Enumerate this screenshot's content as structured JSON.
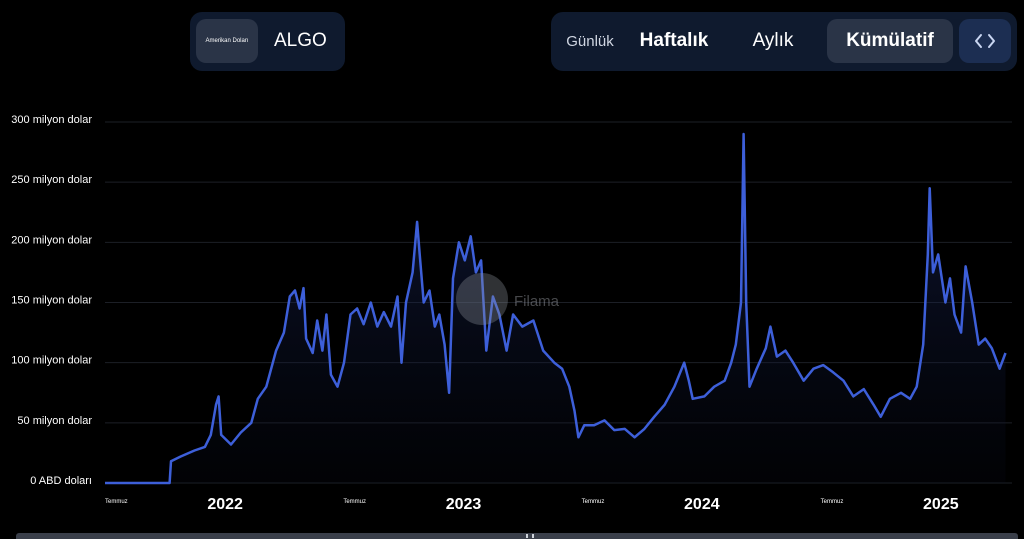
{
  "currency": {
    "label": "Amerikan Doları",
    "asset": "ALGO"
  },
  "range_tabs": [
    {
      "label": "Günlük",
      "active": false
    },
    {
      "label": "Haftalık",
      "active": false
    },
    {
      "label": "Aylık",
      "active": false
    },
    {
      "label": "Kümülatif",
      "active": true
    }
  ],
  "embed": {
    "icon": "code-brackets-icon"
  },
  "watermark": {
    "text": "Filama"
  },
  "colors": {
    "line": "#3d5fd9",
    "background": "#000000",
    "panel": "#0f1a2e",
    "active_tab": "#2a3447",
    "gridline": "#1c1f26",
    "axis_text": "#ffffff"
  },
  "chart_data": {
    "type": "area",
    "title": "",
    "xlabel": "",
    "ylabel": "",
    "grid": true,
    "ylim": [
      0,
      300
    ],
    "y_ticks": [
      {
        "value": 0,
        "label": "0 ABD doları"
      },
      {
        "value": 50,
        "label": "50 milyon dolar"
      },
      {
        "value": 100,
        "label": "100 milyon dolar"
      },
      {
        "value": 150,
        "label": "150 milyon dolar"
      },
      {
        "value": 200,
        "label": "200 milyon dolar"
      },
      {
        "value": 250,
        "label": "250 milyon dolar"
      },
      {
        "value": 300,
        "label": "300 milyon dolar"
      }
    ],
    "x_ticks": [
      {
        "date": "2021-07-01",
        "label": "Temmuz",
        "major": false
      },
      {
        "date": "2022-01-01",
        "label": "2022",
        "major": true
      },
      {
        "date": "2022-07-01",
        "label": "Temmuz",
        "major": false
      },
      {
        "date": "2023-01-01",
        "label": "2023",
        "major": true
      },
      {
        "date": "2023-07-01",
        "label": "Temmuz",
        "major": false
      },
      {
        "date": "2024-01-01",
        "label": "2024",
        "major": true
      },
      {
        "date": "2024-07-01",
        "label": "Temmuz",
        "major": false
      },
      {
        "date": "2025-01-01",
        "label": "2025",
        "major": true
      }
    ],
    "xlim": [
      "2021-07-01",
      "2025-04-20"
    ],
    "series": [
      {
        "unit": "milyon dolar",
        "points": [
          [
            "2021-07-01",
            0
          ],
          [
            "2021-09-15",
            0
          ],
          [
            "2021-10-08",
            0
          ],
          [
            "2021-10-10",
            18
          ],
          [
            "2021-10-25",
            22
          ],
          [
            "2021-11-15",
            27
          ],
          [
            "2021-12-01",
            30
          ],
          [
            "2021-12-10",
            40
          ],
          [
            "2021-12-18",
            65
          ],
          [
            "2021-12-22",
            72
          ],
          [
            "2021-12-26",
            40
          ],
          [
            "2022-01-10",
            32
          ],
          [
            "2022-01-25",
            42
          ],
          [
            "2022-02-10",
            50
          ],
          [
            "2022-02-20",
            70
          ],
          [
            "2022-03-05",
            80
          ],
          [
            "2022-03-20",
            110
          ],
          [
            "2022-04-01",
            125
          ],
          [
            "2022-04-10",
            155
          ],
          [
            "2022-04-18",
            160
          ],
          [
            "2022-04-25",
            145
          ],
          [
            "2022-05-01",
            162
          ],
          [
            "2022-05-05",
            120
          ],
          [
            "2022-05-15",
            108
          ],
          [
            "2022-05-22",
            135
          ],
          [
            "2022-05-30",
            110
          ],
          [
            "2022-06-05",
            140
          ],
          [
            "2022-06-12",
            90
          ],
          [
            "2022-06-22",
            80
          ],
          [
            "2022-07-02",
            100
          ],
          [
            "2022-07-12",
            140
          ],
          [
            "2022-07-22",
            145
          ],
          [
            "2022-08-01",
            132
          ],
          [
            "2022-08-12",
            150
          ],
          [
            "2022-08-22",
            130
          ],
          [
            "2022-09-01",
            142
          ],
          [
            "2022-09-12",
            130
          ],
          [
            "2022-09-22",
            155
          ],
          [
            "2022-09-28",
            100
          ],
          [
            "2022-10-05",
            150
          ],
          [
            "2022-10-15",
            175
          ],
          [
            "2022-10-22",
            217
          ],
          [
            "2022-10-26",
            190
          ],
          [
            "2022-11-01",
            150
          ],
          [
            "2022-11-10",
            160
          ],
          [
            "2022-11-18",
            130
          ],
          [
            "2022-11-25",
            140
          ],
          [
            "2022-12-03",
            115
          ],
          [
            "2022-12-10",
            75
          ],
          [
            "2022-12-16",
            170
          ],
          [
            "2022-12-25",
            200
          ],
          [
            "2023-01-03",
            185
          ],
          [
            "2023-01-12",
            205
          ],
          [
            "2023-01-20",
            175
          ],
          [
            "2023-01-28",
            185
          ],
          [
            "2023-02-05",
            110
          ],
          [
            "2023-02-15",
            155
          ],
          [
            "2023-02-25",
            140
          ],
          [
            "2023-03-08",
            110
          ],
          [
            "2023-03-18",
            140
          ],
          [
            "2023-04-01",
            130
          ],
          [
            "2023-04-18",
            135
          ],
          [
            "2023-05-03",
            110
          ],
          [
            "2023-05-20",
            100
          ],
          [
            "2023-06-01",
            95
          ],
          [
            "2023-06-12",
            80
          ],
          [
            "2023-06-20",
            60
          ],
          [
            "2023-06-26",
            38
          ],
          [
            "2023-07-05",
            48
          ],
          [
            "2023-07-20",
            48
          ],
          [
            "2023-08-05",
            52
          ],
          [
            "2023-08-20",
            44
          ],
          [
            "2023-09-05",
            45
          ],
          [
            "2023-09-20",
            38
          ],
          [
            "2023-10-05",
            45
          ],
          [
            "2023-10-20",
            55
          ],
          [
            "2023-11-05",
            65
          ],
          [
            "2023-11-20",
            80
          ],
          [
            "2023-12-05",
            100
          ],
          [
            "2023-12-12",
            85
          ],
          [
            "2023-12-18",
            70
          ],
          [
            "2024-01-05",
            72
          ],
          [
            "2024-01-20",
            80
          ],
          [
            "2024-02-05",
            85
          ],
          [
            "2024-02-15",
            100
          ],
          [
            "2024-02-22",
            115
          ],
          [
            "2024-03-01",
            150
          ],
          [
            "2024-03-05",
            290
          ],
          [
            "2024-03-09",
            150
          ],
          [
            "2024-03-14",
            80
          ],
          [
            "2024-03-25",
            95
          ],
          [
            "2024-04-08",
            112
          ],
          [
            "2024-04-15",
            130
          ],
          [
            "2024-04-25",
            105
          ],
          [
            "2024-05-08",
            110
          ],
          [
            "2024-05-20",
            100
          ],
          [
            "2024-06-05",
            85
          ],
          [
            "2024-06-20",
            95
          ],
          [
            "2024-07-05",
            98
          ],
          [
            "2024-07-20",
            92
          ],
          [
            "2024-08-05",
            85
          ],
          [
            "2024-08-20",
            72
          ],
          [
            "2024-09-05",
            78
          ],
          [
            "2024-09-20",
            65
          ],
          [
            "2024-10-01",
            55
          ],
          [
            "2024-10-15",
            70
          ],
          [
            "2024-11-01",
            75
          ],
          [
            "2024-11-15",
            70
          ],
          [
            "2024-11-25",
            80
          ],
          [
            "2024-12-05",
            115
          ],
          [
            "2024-12-12",
            190
          ],
          [
            "2024-12-15",
            245
          ],
          [
            "2024-12-20",
            175
          ],
          [
            "2024-12-28",
            190
          ],
          [
            "2025-01-08",
            150
          ],
          [
            "2025-01-15",
            170
          ],
          [
            "2025-01-22",
            140
          ],
          [
            "2025-02-01",
            125
          ],
          [
            "2025-02-08",
            180
          ],
          [
            "2025-02-18",
            150
          ],
          [
            "2025-02-28",
            115
          ],
          [
            "2025-03-10",
            120
          ],
          [
            "2025-03-20",
            112
          ],
          [
            "2025-04-01",
            95
          ],
          [
            "2025-04-10",
            108
          ]
        ]
      }
    ]
  }
}
